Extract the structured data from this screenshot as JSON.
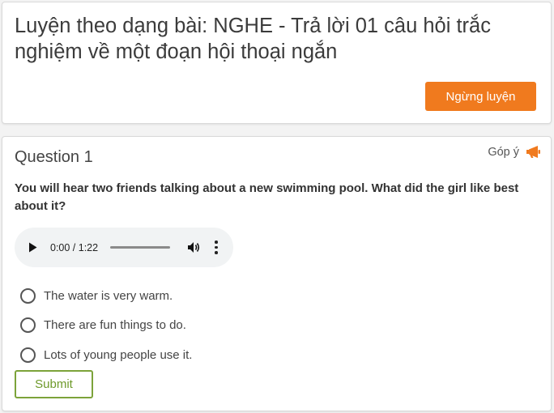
{
  "header": {
    "title": "Luyện theo dạng bài: NGHE - Trả lời 01 câu hỏi trắc nghiệm về một đoạn hội thoại ngắn",
    "stop_label": "Ngừng luyện"
  },
  "question": {
    "title": "Question 1",
    "feedback_label": "Góp ý",
    "prompt": "You will hear two friends talking about a new swimming pool. What did the girl like best about it?",
    "audio": {
      "time": "0:00 / 1:22",
      "progress": 0
    },
    "options": [
      {
        "label": "The water is very warm."
      },
      {
        "label": "There are fun things to do."
      },
      {
        "label": "Lots of young people use it."
      }
    ],
    "submit_label": "Submit"
  },
  "colors": {
    "accent": "#f07a1e",
    "submit": "#7ca33a",
    "background": "#f3f3f3"
  },
  "icons": [
    "megaphone-icon",
    "play-icon",
    "volume-icon",
    "more-options-icon"
  ]
}
